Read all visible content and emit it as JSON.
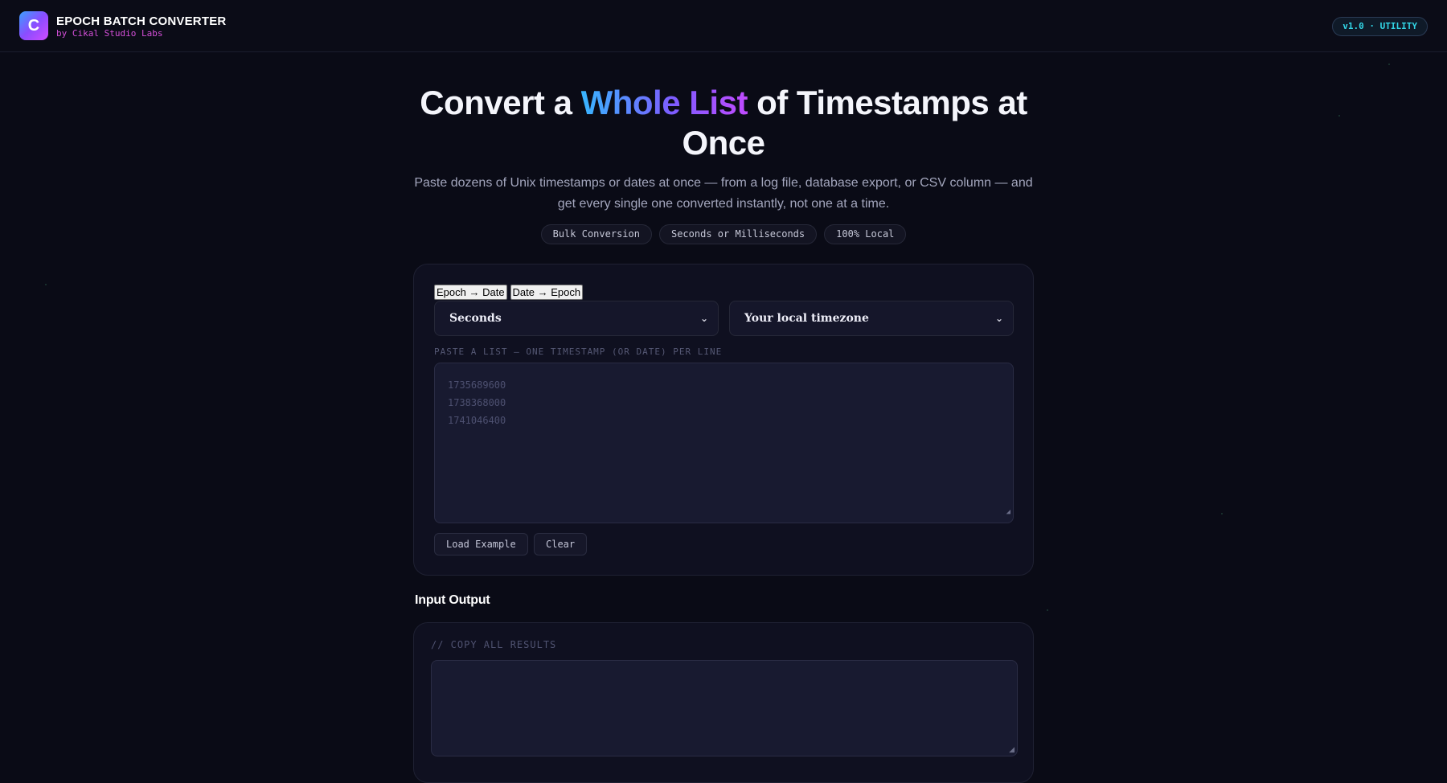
{
  "header": {
    "logo_letter": "C",
    "title": "EPOCH BATCH CONVERTER",
    "subtitle": "by Cikal Studio Labs",
    "version": "v1.0 · UTILITY"
  },
  "hero": {
    "title_before": "Convert a ",
    "title_highlight": "Whole List",
    "title_after": " of Timestamps at Once",
    "description": "Paste dozens of Unix timestamps or dates at once — from a log file, database export, or CSV column — and get every single one converted instantly, not one at a time.",
    "chips": [
      "Bulk Conversion",
      "Seconds or Milliseconds",
      "100% Local"
    ]
  },
  "converter": {
    "tabs": [
      "Epoch → Date",
      "Date → Epoch"
    ],
    "unit_select": "Seconds",
    "timezone_select": "Your local timezone",
    "input_label": "PASTE A LIST — ONE TIMESTAMP (OR DATE) PER LINE",
    "placeholder_lines": [
      "1735689600",
      "1738368000",
      "1741046400"
    ],
    "load_example": "Load Example",
    "clear": "Clear"
  },
  "output": {
    "heading": "Input Output",
    "copy_label": "// COPY ALL RESULTS"
  },
  "colors": {
    "background": "#0a0b16",
    "accent_cyan": "#32d6e6",
    "accent_magenta": "#d44fd8"
  }
}
